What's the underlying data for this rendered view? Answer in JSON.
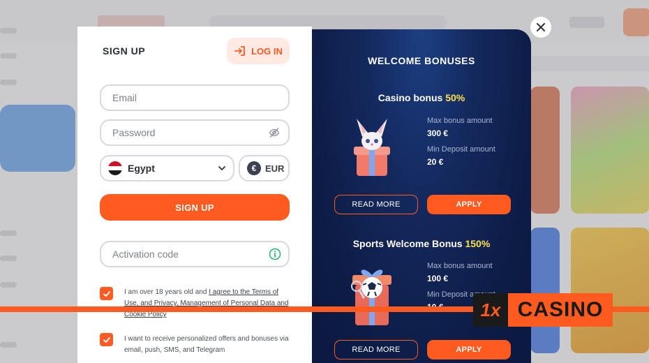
{
  "modal": {
    "signup_title": "SIGN UP",
    "login_label": "LOG IN",
    "email_placeholder": "Email",
    "password_placeholder": "Password",
    "country": "Egypt",
    "currency": "EUR",
    "currency_symbol": "€",
    "signup_button": "SIGN UP",
    "activation_placeholder": "Activation code",
    "agree_prefix": "I am over 18 years old and ",
    "agree_link": "I agree to the Terms of Use, and Privacy, Management of Personal Data and Cookie Policy",
    "agree_line1_a": "I am over 18 years old and ",
    "agree_line1_link": "I agree to the Terms of",
    "agree_line2_link": "Use, and Privacy, Management of Personal Data and",
    "agree_line3_link": "Cookie Policy",
    "offers_line1": "I want to receive personalized offers and bonuses via",
    "offers_line2": "email, push, SMS, and Telegram",
    "checkbox_agree_checked": true,
    "checkbox_offers_checked": true
  },
  "bonuses": {
    "title": "WELCOME BONUSES",
    "items": [
      {
        "name": "Casino bonus",
        "percent": "50%",
        "max_label": "Max bonus amount",
        "max_value": "300 €",
        "min_label": "Min Deposit amount",
        "min_value": "20 €",
        "read_more": "READ MORE",
        "apply": "APPLY"
      },
      {
        "name": "Sports Welcome Bonus",
        "percent": "150%",
        "max_label": "Max bonus amount",
        "max_value": "100 €",
        "min_label": "Min Deposit amount",
        "min_value": "10 €",
        "read_more": "READ MORE",
        "apply": "APPLY"
      }
    ]
  },
  "watermark": {
    "mark": "1x",
    "text": "CASINO"
  },
  "colors": {
    "accent": "#ff5a1f",
    "panel_dark": "#0d1c45",
    "highlight": "#ffe14d"
  }
}
